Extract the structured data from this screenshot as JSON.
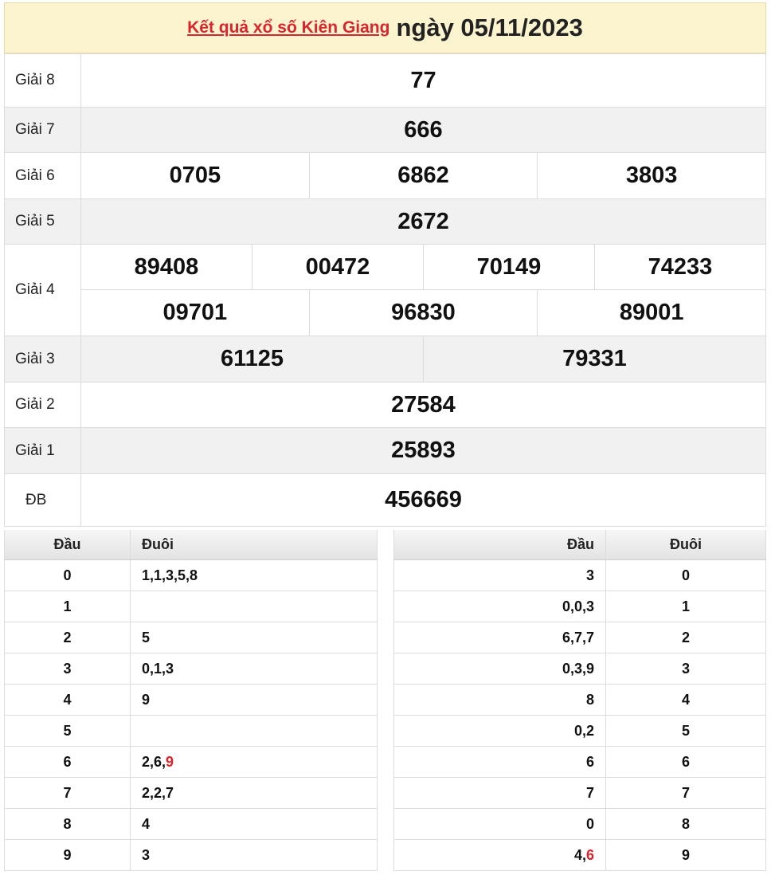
{
  "header": {
    "link_text": "Kết quả xổ số Kiên Giang",
    "date_text": "ngày 05/11/2023"
  },
  "prizes": {
    "g8": {
      "label": "Giải 8",
      "values": [
        "77"
      ]
    },
    "g7": {
      "label": "Giải 7",
      "values": [
        "666"
      ]
    },
    "g6": {
      "label": "Giải 6",
      "values": [
        "0705",
        "6862",
        "3803"
      ]
    },
    "g5": {
      "label": "Giải 5",
      "values": [
        "2672"
      ]
    },
    "g4": {
      "label": "Giải 4",
      "values": [
        "89408",
        "00472",
        "70149",
        "74233",
        "09701",
        "96830",
        "89001"
      ]
    },
    "g3": {
      "label": "Giải 3",
      "values": [
        "61125",
        "79331"
      ]
    },
    "g2": {
      "label": "Giải 2",
      "values": [
        "27584"
      ]
    },
    "g1": {
      "label": "Giải 1",
      "values": [
        "25893"
      ]
    },
    "db": {
      "label": "ĐB",
      "values": [
        "456669"
      ]
    }
  },
  "loto_left": {
    "head_label": "Đầu",
    "tail_label": "Đuôi",
    "rows": [
      {
        "dau": "0",
        "duoi": "1,1,3,5,8"
      },
      {
        "dau": "1",
        "duoi": ""
      },
      {
        "dau": "2",
        "duoi": "5"
      },
      {
        "dau": "3",
        "duoi": "0,1,3"
      },
      {
        "dau": "4",
        "duoi": "9"
      },
      {
        "dau": "5",
        "duoi": ""
      },
      {
        "dau": "6",
        "duoi": "2,6,",
        "duoi_red": "9"
      },
      {
        "dau": "7",
        "duoi": "2,2,7"
      },
      {
        "dau": "8",
        "duoi": "4"
      },
      {
        "dau": "9",
        "duoi": "3"
      }
    ]
  },
  "loto_right": {
    "head_label": "Đầu",
    "tail_label": "Đuôi",
    "rows": [
      {
        "dau": "3",
        "duoi": "0"
      },
      {
        "dau": "0,0,3",
        "duoi": "1"
      },
      {
        "dau": "6,7,7",
        "duoi": "2"
      },
      {
        "dau": "0,3,9",
        "duoi": "3"
      },
      {
        "dau": "8",
        "duoi": "4"
      },
      {
        "dau": "0,2",
        "duoi": "5"
      },
      {
        "dau": "6",
        "duoi": "6"
      },
      {
        "dau": "7",
        "duoi": "7"
      },
      {
        "dau": "0",
        "duoi": "8"
      },
      {
        "dau": "4,",
        "dau_red": "6",
        "duoi": "9"
      }
    ]
  },
  "colors": {
    "red": "#e0202a",
    "header_bg": "#fcf3cf",
    "alt_row": "#f1f1f1"
  }
}
